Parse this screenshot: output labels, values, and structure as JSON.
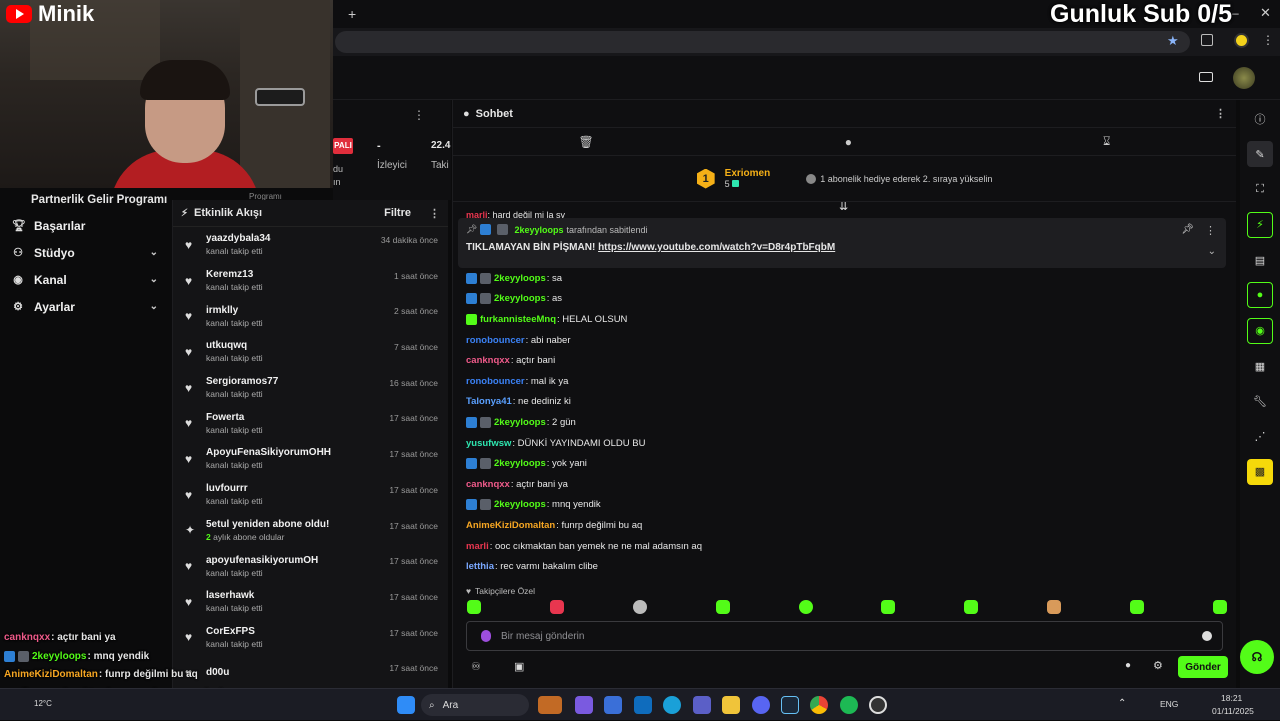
{
  "overlay": {
    "brand": "Minik",
    "sub_goal": "Gunluk Sub 0/5"
  },
  "sidebar": {
    "partner": "Partnerlik Gelir Programı",
    "items": [
      {
        "label": "Başarılar",
        "icon": "trophy-icon",
        "expandable": false
      },
      {
        "label": "Stüdyo",
        "icon": "studio-icon",
        "expandable": true
      },
      {
        "label": "Kanal",
        "icon": "channel-icon",
        "expandable": true
      },
      {
        "label": "Ayarlar",
        "icon": "gear-icon",
        "expandable": true
      }
    ]
  },
  "stats": {
    "badge": "PALI",
    "dash": "-",
    "viewers_label": "İzleyici",
    "value": "22.4",
    "next_label": "Taki",
    "frag_a": "du",
    "frag_b": "ın",
    "frag_c": "Programı"
  },
  "feed": {
    "title": "Etkinlik Akışı",
    "filter": "Filtre",
    "items": [
      {
        "user": "yaazdybala34",
        "action": "kanalı takip etti",
        "time": "34 dakika önce",
        "type": "follow"
      },
      {
        "user": "Keremz13",
        "action": "kanalı takip etti",
        "time": "1 saat önce",
        "type": "follow"
      },
      {
        "user": "irmklly",
        "action": "kanalı takip etti",
        "time": "2 saat önce",
        "type": "follow"
      },
      {
        "user": "utkuqwq",
        "action": "kanalı takip etti",
        "time": "7 saat önce",
        "type": "follow"
      },
      {
        "user": "Sergioramos77",
        "action": "kanalı takip etti",
        "time": "16 saat önce",
        "type": "follow"
      },
      {
        "user": "Fowerta",
        "action": "kanalı takip etti",
        "time": "17 saat önce",
        "type": "follow"
      },
      {
        "user": "ApoyuFenaSikiyorumOHH",
        "action": "kanalı takip etti",
        "time": "17 saat önce",
        "type": "follow"
      },
      {
        "user": "luvfourrr",
        "action": "kanalı takip etti",
        "time": "17 saat önce",
        "type": "follow"
      },
      {
        "user": "5etul yeniden abone oldu!",
        "action_prefix": "2",
        "action": "aylık abone oldular",
        "time": "17 saat önce",
        "type": "sub"
      },
      {
        "user": "apoyufenasikiyorumOH",
        "action": "kanalı takip etti",
        "time": "17 saat önce",
        "type": "follow"
      },
      {
        "user": "laserhawk",
        "action": "kanalı takip etti",
        "time": "17 saat önce",
        "type": "follow"
      },
      {
        "user": "CorExFPS",
        "action": "kanalı takip etti",
        "time": "17 saat önce",
        "type": "follow"
      },
      {
        "user": "d00u",
        "action": "",
        "time": "17 saat önce",
        "type": "follow"
      }
    ]
  },
  "chat": {
    "title": "Sohbet",
    "leader": {
      "rank": "1",
      "name": "Exriomen",
      "count": "5",
      "prompt": "1 abonelik hediye ederek 2. sıraya yükselin"
    },
    "cut_msg": {
      "user": "marli",
      "text": ": hard değil mi la sy"
    },
    "pinned": {
      "user": "2keyyloops",
      "by": "tarafından sabitlendi",
      "text": "TIKLAMAYAN BİN PİŞMAN!",
      "link": "https://www.youtube.com/watch?v=D8r4pTbFqbM"
    },
    "messages": [
      {
        "user": "2keyyloops",
        "color": "#53fc18",
        "badges": [
          "mod",
          "vip"
        ],
        "text": ": sa"
      },
      {
        "user": "2keyyloops",
        "color": "#53fc18",
        "badges": [
          "mod",
          "vip"
        ],
        "text": ": as"
      },
      {
        "user": "furkannisteeMnq",
        "color": "#53fc18",
        "badges": [
          "sub"
        ],
        "text": ": HELAL OLSUN"
      },
      {
        "user": "ronobouncer",
        "color": "#3b82f6",
        "badges": [],
        "text": ": abi naber"
      },
      {
        "user": "canknqxx",
        "color": "#ef5a8a",
        "badges": [],
        "text": ": açtır bani"
      },
      {
        "user": "ronobouncer",
        "color": "#3b82f6",
        "badges": [],
        "text": ": mal ik ya"
      },
      {
        "user": "Talonya41",
        "color": "#5aa0ff",
        "badges": [],
        "text": ": ne dediniz ki"
      },
      {
        "user": "2keyyloops",
        "color": "#53fc18",
        "badges": [
          "mod",
          "vip"
        ],
        "text": ": 2 gün"
      },
      {
        "user": "yusufwsw",
        "color": "#2ee6b0",
        "badges": [],
        "text": ": DÜNKİ YAYINDAMI OLDU BU"
      },
      {
        "user": "2keyyloops",
        "color": "#53fc18",
        "badges": [
          "mod",
          "vip"
        ],
        "text": ": yok yani"
      },
      {
        "user": "canknqxx",
        "color": "#ef5a8a",
        "badges": [],
        "text": ": açtır bani ya"
      },
      {
        "user": "2keyyloops",
        "color": "#53fc18",
        "badges": [
          "mod",
          "vip"
        ],
        "text": ": mnq yendik"
      },
      {
        "user": "AnimeKiziDomaltan",
        "color": "#f6a623",
        "badges": [],
        "text": ": funrp değilmi bu aq"
      },
      {
        "user": "marli",
        "color": "#e8364f",
        "badges": [],
        "text": ": ooc cıkmaktan ban yemek ne ne mal adamsın aq"
      },
      {
        "user": "letthia",
        "color": "#7aa8ff",
        "badges": [],
        "text": ": rec varmı bakalım clibe"
      }
    ],
    "followers_only": "Takipçilere Özel",
    "input_placeholder": "Bir mesaj gönderin",
    "send_label": "Gönder"
  },
  "overlay_chat": [
    {
      "user": "canknqxx",
      "color": "#ef5a8a",
      "badges": [],
      "text": ": açtır bani ya"
    },
    {
      "user": "2keyyloops",
      "color": "#53fc18",
      "badges": [
        "mod",
        "vip"
      ],
      "text": ": mnq yendik"
    },
    {
      "user": "AnimeKiziDomaltan",
      "color": "#f6a623",
      "badges": [],
      "text": ": funrp değilmi bu aq"
    },
    {
      "user": "marli",
      "color": "#e8364f",
      "badges": [],
      "text": ": ooc cıkmaktan ban yemek ne ne mal adamsın aq"
    },
    {
      "user": "letthia",
      "color": "#7aa8ff",
      "badges": [],
      "text": ": rec varmı bakalım clibe"
    }
  ],
  "taskbar": {
    "search": "Ara",
    "weather": "12°C",
    "lang": "ENG",
    "time": "18:21",
    "date": "01/11/2025"
  },
  "colors": {
    "accent": "#53fc18",
    "background": "#0f0f11",
    "panel": "#141416"
  }
}
